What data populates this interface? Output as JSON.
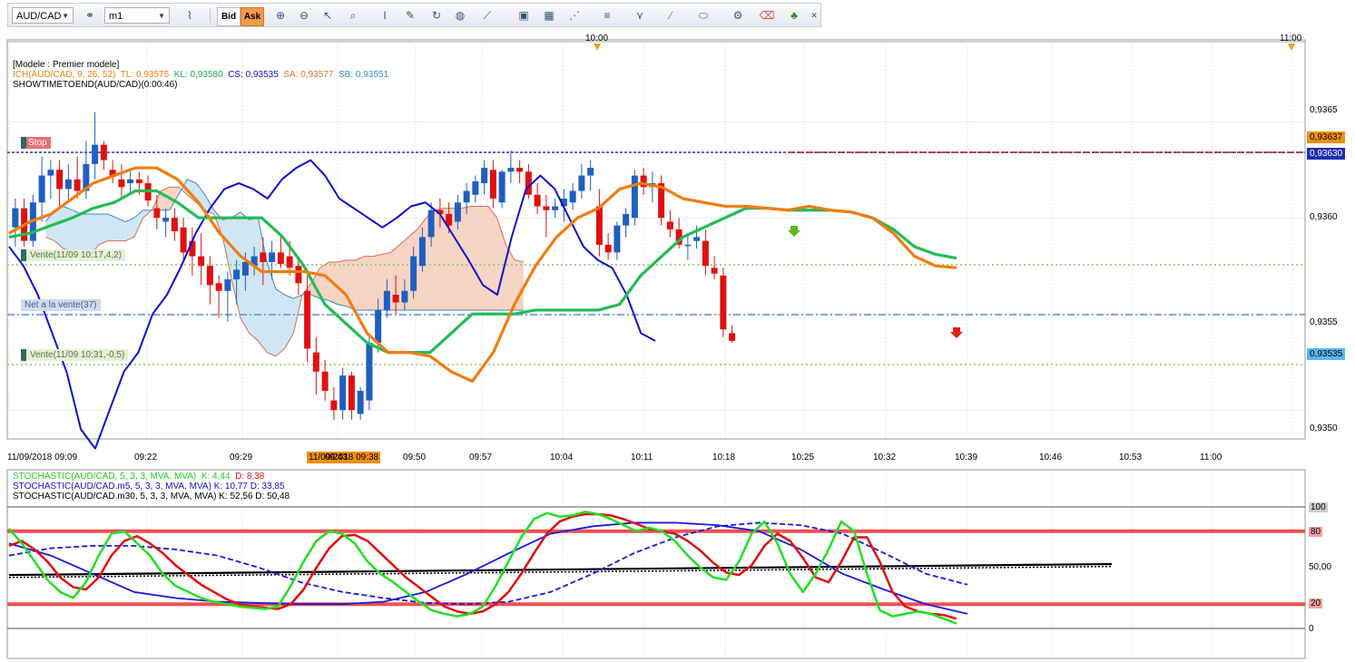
{
  "toolbar": {
    "symbol": "AUD/CAD",
    "timeframe": "m1",
    "bid_label": "Bid",
    "ask_label": "Ask",
    "icons": [
      "link-icon",
      "line-chart-icon",
      "crosshair-icon",
      "zoom-in-icon",
      "zoom-out-icon",
      "cursor-icon",
      "zoom-area-icon",
      "cursor-text-icon",
      "edit-icon",
      "refresh-icon",
      "globe-icon",
      "ruler-icon",
      "image-icon",
      "grid-icon",
      "draw-icon",
      "lines-icon",
      "trend-icon",
      "pencil-icon",
      "ellipse-icon",
      "settings-icon",
      "eraser-icon",
      "tree-icon",
      "close-icon"
    ]
  },
  "colors": {
    "bull": "#1f5fbf",
    "bear": "#e01010",
    "tenkan": "#f07d10",
    "kijun": "#22bb55",
    "chikou": "#1010d0",
    "cloud_bull": "#cfe6f3",
    "cloud_bear": "#f6d4c4",
    "stop_line": "#c01818",
    "net_line": "#5a8fe0",
    "trade_line": "#8ec46a"
  },
  "legend": {
    "line1": "[Modele : Premier modele]",
    "ich_name": "ICH(AUD/CAD, 9, 26, 52)",
    "tl": "TL: 0,93575",
    "kl": "KL: 0,93580",
    "cs": "CS: 0,93535",
    "sa": "SA: 0,93577",
    "sb": "SB: 0,93551",
    "line3": "SHOWTIMETOEND(AUD/CAD)(0:00:46)"
  },
  "top_time_labels": [
    "10:00",
    "11:00"
  ],
  "price_ticks": [
    "0,9365",
    "0,9360",
    "0,9355",
    "0,9350"
  ],
  "price_tags": {
    "stop": "0,93637",
    "current": "0,93630",
    "cs": "0,93535"
  },
  "annotations": {
    "stop": "Stop",
    "trade1": "Vente(11/09 10:17,4,2)",
    "net": "Net a la vente(37)",
    "trade2": "Vente(11/09 10:31,-0,5)"
  },
  "time_axis": {
    "highlight": "11/09/2018 09:38",
    "labels": [
      "11/09/2018 09:09",
      "09:22",
      "09:29",
      "09:43",
      "09:50",
      "09:57",
      "10:04",
      "10:11",
      "10:18",
      "10:25",
      "10:32",
      "10:39",
      "10:46",
      "10:53",
      "11:00"
    ]
  },
  "stoch_legend": {
    "s1_name": "STOCHASTIC(AUD/CAD, 5, 3, 3, MVA, MVA)",
    "s1_k": "K: 4,44",
    "s1_d": "D: 8,38",
    "s2": "STOCHASTIC(AUD/CAD.m5, 5, 3, 3, MVA, MVA)  K: 10,77  D: 33,85",
    "s3": "STOCHASTIC(AUD/CAD.m30, 5, 3, 3, MVA, MVA)  K: 52,56  D: 50,48"
  },
  "stoch_ticks": [
    "100",
    "80",
    "50,00",
    "20",
    "0"
  ],
  "chart_data": {
    "type": "candlestick",
    "ylim": [
      0.93485,
      0.93685
    ],
    "grid": true,
    "candles": [
      [
        0.93595,
        0.9361,
        0.93585,
        0.93605
      ],
      [
        0.93605,
        0.9361,
        0.93585,
        0.93588
      ],
      [
        0.93588,
        0.93612,
        0.93585,
        0.93608
      ],
      [
        0.93608,
        0.93632,
        0.93598,
        0.93622
      ],
      [
        0.93622,
        0.9363,
        0.9361,
        0.93625
      ],
      [
        0.93625,
        0.9363,
        0.93605,
        0.93615
      ],
      [
        0.93615,
        0.93628,
        0.93608,
        0.9362
      ],
      [
        0.9362,
        0.93632,
        0.9361,
        0.93614
      ],
      [
        0.93614,
        0.9364,
        0.9361,
        0.93628
      ],
      [
        0.93628,
        0.93655,
        0.9362,
        0.93638
      ],
      [
        0.93638,
        0.9364,
        0.93625,
        0.9363
      ],
      [
        0.93625,
        0.9363,
        0.93618,
        0.93622
      ],
      [
        0.9362,
        0.93628,
        0.9361,
        0.93616
      ],
      [
        0.93618,
        0.93625,
        0.93612,
        0.9362
      ],
      [
        0.9362,
        0.93624,
        0.93612,
        0.93618
      ],
      [
        0.93618,
        0.93622,
        0.93606,
        0.93609
      ],
      [
        0.93605,
        0.93612,
        0.93594,
        0.936
      ],
      [
        0.93598,
        0.93605,
        0.9359,
        0.936
      ],
      [
        0.936,
        0.93605,
        0.93588,
        0.93593
      ],
      [
        0.93595,
        0.936,
        0.93578,
        0.93582
      ],
      [
        0.93588,
        0.93595,
        0.9357,
        0.9358
      ],
      [
        0.9358,
        0.93592,
        0.93565,
        0.93575
      ],
      [
        0.93575,
        0.9358,
        0.93555,
        0.93565
      ],
      [
        0.93566,
        0.9357,
        0.93548,
        0.93562
      ],
      [
        0.93562,
        0.93572,
        0.93546,
        0.93568
      ],
      [
        0.93568,
        0.93578,
        0.93555,
        0.93573
      ],
      [
        0.9357,
        0.93582,
        0.93562,
        0.93577
      ],
      [
        0.93575,
        0.93585,
        0.9357,
        0.9358
      ],
      [
        0.93582,
        0.9359,
        0.93565,
        0.93577
      ],
      [
        0.93577,
        0.93588,
        0.93568,
        0.93582
      ],
      [
        0.93582,
        0.9359,
        0.93574,
        0.93576
      ],
      [
        0.9358,
        0.93588,
        0.9357,
        0.93574
      ],
      [
        0.93575,
        0.9358,
        0.9356,
        0.93566
      ],
      [
        0.93562,
        0.9357,
        0.93525,
        0.93532
      ],
      [
        0.9353,
        0.93538,
        0.93508,
        0.9352
      ],
      [
        0.9352,
        0.93526,
        0.93505,
        0.9351
      ],
      [
        0.93505,
        0.93512,
        0.93495,
        0.935
      ],
      [
        0.935,
        0.93522,
        0.93495,
        0.93518
      ],
      [
        0.93518,
        0.9352,
        0.93495,
        0.935
      ],
      [
        0.93498,
        0.93512,
        0.93495,
        0.9351
      ],
      [
        0.93505,
        0.9354,
        0.935,
        0.93535
      ],
      [
        0.93535,
        0.93558,
        0.9353,
        0.93552
      ],
      [
        0.93552,
        0.93568,
        0.93548,
        0.93562
      ],
      [
        0.9356,
        0.9357,
        0.9355,
        0.93556
      ],
      [
        0.93556,
        0.93568,
        0.93552,
        0.93562
      ],
      [
        0.93562,
        0.93585,
        0.93558,
        0.9358
      ],
      [
        0.93575,
        0.93595,
        0.93572,
        0.9359
      ],
      [
        0.9359,
        0.93608,
        0.93585,
        0.93604
      ],
      [
        0.93604,
        0.9361,
        0.93595,
        0.93602
      ],
      [
        0.93602,
        0.93608,
        0.93592,
        0.93596
      ],
      [
        0.93598,
        0.93612,
        0.93594,
        0.93608
      ],
      [
        0.93608,
        0.93618,
        0.93602,
        0.93614
      ],
      [
        0.93612,
        0.93622,
        0.93608,
        0.93619
      ],
      [
        0.93618,
        0.9363,
        0.93612,
        0.93626
      ],
      [
        0.93625,
        0.9363,
        0.93605,
        0.9361
      ],
      [
        0.93608,
        0.93625,
        0.93605,
        0.93624
      ],
      [
        0.93624,
        0.93635,
        0.93618,
        0.93626
      ],
      [
        0.93626,
        0.9363,
        0.93618,
        0.93624
      ],
      [
        0.93624,
        0.93628,
        0.9361,
        0.93612
      ],
      [
        0.93612,
        0.93618,
        0.93602,
        0.93606
      ],
      [
        0.93606,
        0.93612,
        0.9359,
        0.93604
      ],
      [
        0.93604,
        0.9361,
        0.936,
        0.93606
      ],
      [
        0.93606,
        0.93615,
        0.93598,
        0.9361
      ],
      [
        0.93608,
        0.93618,
        0.93604,
        0.93614
      ],
      [
        0.93614,
        0.93628,
        0.9361,
        0.93622
      ],
      [
        0.93622,
        0.9363,
        0.93614,
        0.93626
      ],
      [
        0.93606,
        0.93615,
        0.9358,
        0.93586
      ],
      [
        0.93586,
        0.93592,
        0.93578,
        0.93582
      ],
      [
        0.93582,
        0.93598,
        0.93578,
        0.93596
      ],
      [
        0.93596,
        0.93605,
        0.9359,
        0.93602
      ],
      [
        0.936,
        0.93625,
        0.93596,
        0.93622
      ],
      [
        0.93622,
        0.93626,
        0.93612,
        0.93616
      ],
      [
        0.93616,
        0.93624,
        0.93608,
        0.93618
      ],
      [
        0.93618,
        0.93622,
        0.93596,
        0.936
      ],
      [
        0.93598,
        0.93604,
        0.9359,
        0.93594
      ],
      [
        0.93594,
        0.936,
        0.93584,
        0.93586
      ],
      [
        0.93586,
        0.93592,
        0.93578,
        0.93586
      ],
      [
        0.93588,
        0.93596,
        0.93584,
        0.9359
      ],
      [
        0.93588,
        0.93594,
        0.9357,
        0.93575
      ],
      [
        0.93574,
        0.9358,
        0.93568,
        0.93571
      ],
      [
        0.9357,
        0.93574,
        0.93538,
        0.93542
      ],
      [
        0.9354,
        0.93544,
        0.93535,
        0.93536
      ]
    ],
    "tenkan": [
      0.93592,
      0.93598,
      0.93602,
      0.9361,
      0.93618,
      0.93622,
      0.93626,
      0.93626,
      0.9362,
      0.93608,
      0.93592,
      0.9358,
      0.93572,
      0.93572,
      0.93572,
      0.9357,
      0.9356,
      0.9354,
      0.9353,
      0.9353,
      0.93528,
      0.9352,
      0.93515,
      0.9353,
      0.93555,
      0.93575,
      0.9359,
      0.936,
      0.93605,
      0.93615,
      0.93618,
      0.93616,
      0.9361,
      0.93608,
      0.93606,
      0.93606,
      0.93605,
      0.93604,
      0.93606,
      0.93604,
      0.93603,
      0.936,
      0.93592,
      0.9358,
      0.93575,
      0.93574
    ],
    "kijun": [
      0.9359,
      0.93592,
      0.93596,
      0.936,
      0.93605,
      0.93608,
      0.93614,
      0.93614,
      0.93608,
      0.936,
      0.936,
      0.936,
      0.936,
      0.9359,
      0.93575,
      0.93555,
      0.93545,
      0.93535,
      0.9353,
      0.9353,
      0.9353,
      0.9354,
      0.9355,
      0.9355,
      0.9355,
      0.93552,
      0.93552,
      0.93552,
      0.93552,
      0.93555,
      0.9357,
      0.9358,
      0.9359,
      0.93595,
      0.936,
      0.93605,
      0.93605,
      0.93604,
      0.93604,
      0.93604,
      0.93603,
      0.936,
      0.93594,
      0.93585,
      0.93581,
      0.93579
    ],
    "chikou": [
      0.93585,
      0.93575,
      0.9356,
      0.9354,
      0.9352,
      0.9349,
      0.9348,
      0.935,
      0.9352,
      0.9353,
      0.9355,
      0.9356,
      0.93575,
      0.93592,
      0.93605,
      0.93615,
      0.93618,
      0.93615,
      0.9361,
      0.9362,
      0.93626,
      0.9363,
      0.93622,
      0.9361,
      0.93605,
      0.936,
      0.93595,
      0.936,
      0.93606,
      0.93608,
      0.93602,
      0.9359,
      0.93578,
      0.93565,
      0.9356,
      0.9359,
      0.93615,
      0.93622,
      0.93615,
      0.936,
      0.93585,
      0.93578,
      0.93574,
      0.9356,
      0.9354,
      0.93536
    ],
    "senkou_a": [
      0.93598,
      0.93604,
      0.93606,
      0.93604,
      0.93602,
      0.93602,
      0.93602,
      0.93602,
      0.936,
      0.93598,
      0.936,
      0.93604,
      0.93604,
      0.93604,
      0.93604,
      0.93612,
      0.9362,
      0.93618,
      0.93612,
      0.93604,
      0.93599,
      0.936,
      0.93603,
      0.93599,
      0.936,
      0.93577,
      0.93563,
      0.9356,
      0.93558,
      0.9356,
      0.9356,
      0.93558,
      0.93557,
      0.93555,
      0.93554,
      0.93552,
      0.93552,
      0.93552,
      0.93552,
      0.93552,
      0.93552,
      0.93552,
      0.93552,
      0.93552,
      0.93552,
      0.93552,
      0.93552,
      0.93552,
      0.93552,
      0.93552,
      0.93552,
      0.93552,
      0.93552,
      0.93552,
      0.93552
    ],
    "senkou_b": [
      0.9359,
      0.93588,
      0.93584,
      0.93582,
      0.9358,
      0.9358,
      0.93586,
      0.93588,
      0.93588,
      0.93588,
      0.9359,
      0.936,
      0.93604,
      0.93614,
      0.93616,
      0.93616,
      0.93612,
      0.93608,
      0.93604,
      0.93602,
      0.9359,
      0.93568,
      0.93548,
      0.9354,
      0.93536,
      0.9353,
      0.93528,
      0.93532,
      0.9354,
      0.9356,
      0.93566,
      0.93574,
      0.93577,
      0.93577,
      0.93578,
      0.93578,
      0.9358,
      0.9358,
      0.93581,
      0.93582,
      0.93586,
      0.9359,
      0.93594,
      0.936,
      0.93604,
      0.93605,
      0.93605,
      0.93605,
      0.93606,
      0.93606,
      0.93606,
      0.936,
      0.93586,
      0.93578,
      0.93577
    ],
    "stoch_m1_k": [
      82,
      70,
      55,
      40,
      30,
      25,
      38,
      60,
      78,
      80,
      70,
      60,
      45,
      35,
      30,
      25,
      22,
      20,
      18,
      17,
      16,
      18,
      35,
      55,
      72,
      80,
      78,
      70,
      55,
      45,
      38,
      30,
      22,
      15,
      12,
      10,
      12,
      18,
      35,
      55,
      75,
      90,
      95,
      92,
      93,
      96,
      94,
      90,
      85,
      80,
      83,
      80,
      72,
      60,
      50,
      42,
      40,
      55,
      78,
      88,
      70,
      45,
      30,
      45,
      65,
      88,
      80,
      45,
      15,
      10,
      12,
      14,
      12,
      8,
      4
    ],
    "stoch_m1_d": [
      68,
      72,
      65,
      55,
      42,
      34,
      32,
      42,
      60,
      72,
      76,
      70,
      62,
      52,
      44,
      36,
      30,
      24,
      20,
      18,
      17,
      16,
      20,
      32,
      50,
      66,
      76,
      77,
      72,
      62,
      52,
      42,
      34,
      26,
      18,
      14,
      12,
      14,
      20,
      30,
      45,
      62,
      78,
      88,
      92,
      94,
      94,
      93,
      90,
      86,
      82,
      80,
      78,
      72,
      64,
      54,
      46,
      44,
      52,
      68,
      78,
      72,
      58,
      42,
      38,
      55,
      75,
      75,
      55,
      30,
      18,
      14,
      12,
      11,
      8
    ]
  }
}
